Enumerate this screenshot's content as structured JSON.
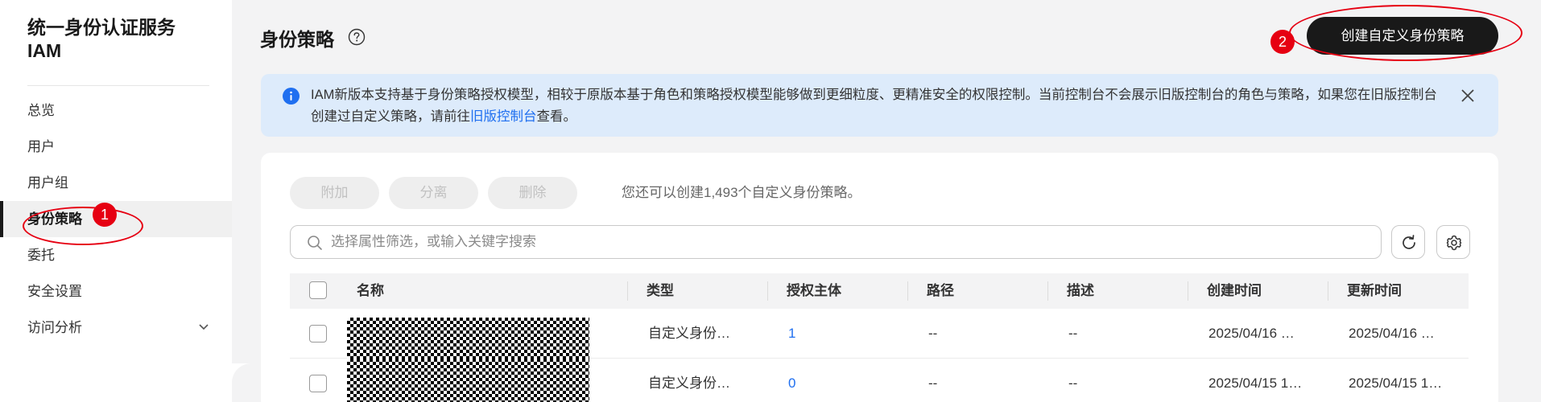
{
  "sidebar": {
    "brand_line1": "统一身份认证服务",
    "brand_line2": "IAM",
    "items": [
      {
        "label": "总览"
      },
      {
        "label": "用户"
      },
      {
        "label": "用户组"
      },
      {
        "label": "身份策略",
        "active": true
      },
      {
        "label": "委托"
      },
      {
        "label": "安全设置"
      },
      {
        "label": "访问分析",
        "expandable": true
      }
    ]
  },
  "header": {
    "title": "身份策略",
    "create_button": "创建自定义身份策略"
  },
  "annotations": {
    "badge1": "1",
    "badge2": "2",
    "color": "#e60012"
  },
  "banner": {
    "text_before": "IAM新版本支持基于身份策略授权模型，相较于原版本基于角色和策略授权模型能够做到更细粒度、更精准安全的权限控制。当前控制台不会展示旧版控制台的角色与策略，如果您在旧版控制台创建过自定义策略，请前往",
    "link_text": "旧版控制台",
    "text_after": "查看。"
  },
  "toolbar": {
    "attach": "附加",
    "detach": "分离",
    "delete": "删除",
    "quota": "您还可以创建1,493个自定义身份策略。"
  },
  "search": {
    "placeholder": "选择属性筛选，或输入关键字搜索",
    "value": ""
  },
  "table": {
    "columns": [
      "名称",
      "类型",
      "授权主体",
      "路径",
      "描述",
      "创建时间",
      "更新时间"
    ],
    "rows": [
      {
        "type": "自定义身份…",
        "principals": "1",
        "path": "--",
        "desc": "--",
        "created": "2025/04/16 …",
        "updated": "2025/04/16 …"
      },
      {
        "type": "自定义身份…",
        "principals": "0",
        "path": "--",
        "desc": "--",
        "created": "2025/04/15 1…",
        "updated": "2025/04/15 1…"
      }
    ]
  },
  "colors": {
    "primary_button": "#191919",
    "link": "#1f6ff0",
    "banner_bg": "#ddebfb",
    "info_icon": "#1f6ff0"
  }
}
